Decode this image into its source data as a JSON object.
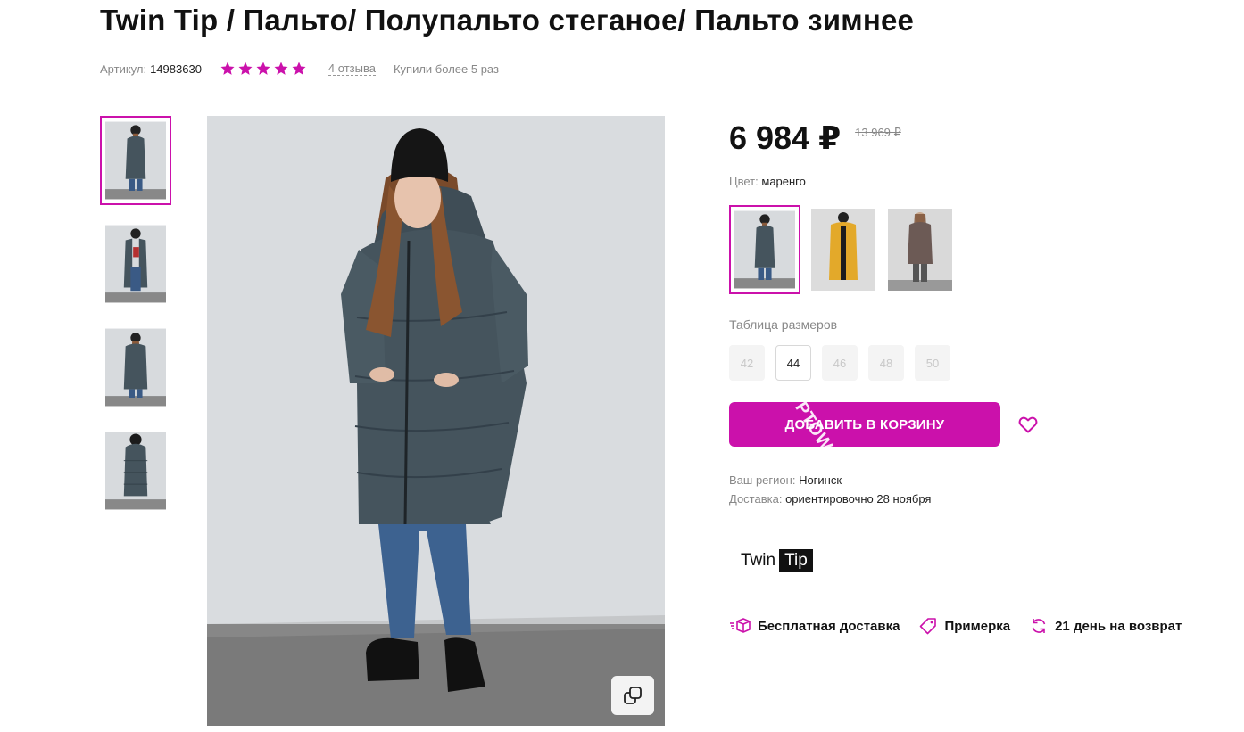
{
  "product": {
    "title": "Twin Tip / Пальто/ Полупальто стеганое/ Пальто зимнее",
    "sku_label": "Артикул:",
    "sku": "14983630",
    "rating": 5,
    "reviews": "4 отзыва",
    "bought": "Купили более 5 раз"
  },
  "gallery": {
    "thumbnails": [
      {
        "alt": "front view",
        "active": true
      },
      {
        "alt": "front open view",
        "active": false
      },
      {
        "alt": "front view 2",
        "active": false
      },
      {
        "alt": "back view",
        "active": false
      }
    ]
  },
  "pricing": {
    "price": "6 984 ₽",
    "old_price": "13 969 ₽"
  },
  "color": {
    "label": "Цвет:",
    "value": "маренго",
    "options": [
      {
        "name": "маренго",
        "coat_color": "#45545d",
        "active": true
      },
      {
        "name": "горчичный",
        "coat_color": "#e3a92a",
        "active": false
      },
      {
        "name": "коричневый",
        "coat_color": "#6c5a55",
        "active": false
      }
    ]
  },
  "sizes": {
    "table_label": "Таблица размеров",
    "options": [
      {
        "label": "42",
        "selected": false
      },
      {
        "label": "44",
        "selected": true
      },
      {
        "label": "46",
        "selected": false
      },
      {
        "label": "48",
        "selected": false
      },
      {
        "label": "50",
        "selected": false
      }
    ]
  },
  "cart": {
    "button_label": "Добавить в корзину",
    "watermark": "ptowaro"
  },
  "delivery": {
    "region_label": "Ваш регион:",
    "region_value": "Ногинск",
    "delivery_label": "Доставка:",
    "delivery_value": "ориентировочно 28 ноября"
  },
  "brand": {
    "logo_part1": "Twin",
    "logo_part2": "Tip"
  },
  "features": [
    {
      "icon": "delivery-box-icon",
      "label": "Бесплатная доставка"
    },
    {
      "icon": "tag-icon",
      "label": "Примерка"
    },
    {
      "icon": "refresh-icon",
      "label": "21 день на возврат"
    }
  ],
  "colors": {
    "accent": "#cb11ab",
    "coat": "#45545d",
    "muted_text": "#888888"
  }
}
